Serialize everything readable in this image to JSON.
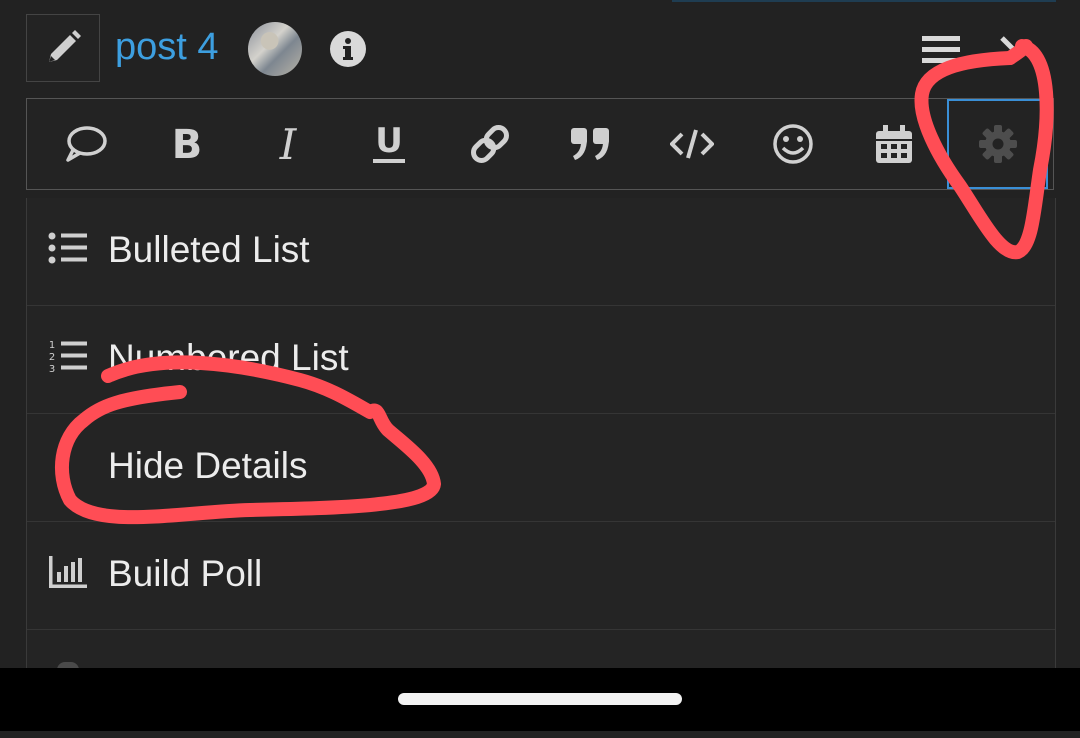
{
  "header": {
    "topic_link": "post 4",
    "icons": [
      "pencil-icon",
      "avatar",
      "info-icon",
      "hamburger-menu-icon",
      "chevron-icon"
    ]
  },
  "toolbar": {
    "buttons": [
      "quote-icon",
      "bold-icon",
      "italic-icon",
      "underline-icon",
      "link-icon",
      "blockquote-icon",
      "code-icon",
      "emoji-icon",
      "calendar-icon",
      "gear-icon"
    ],
    "active_button": "gear-icon"
  },
  "popup_menu": {
    "items": [
      {
        "label": "Bulleted List",
        "icon": "bulleted-list-icon"
      },
      {
        "label": "Numbered List",
        "icon": "numbered-list-icon"
      },
      {
        "label": "Hide Details",
        "icon": ""
      },
      {
        "label": "Build Poll",
        "icon": "poll-chart-icon"
      }
    ]
  },
  "colors": {
    "background": "#222222",
    "link": "#3d9fe0",
    "active_outline": "#3a8fd6",
    "annotation": "#ff4d55"
  }
}
